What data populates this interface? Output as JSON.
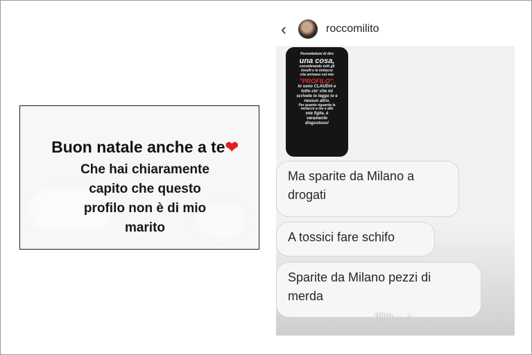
{
  "left_story": {
    "greeting": "Buon natale anche a te",
    "reply_lines": [
      "Che hai chiaramente",
      "capito che questo",
      "profilo non è di mio",
      "marito"
    ]
  },
  "dm": {
    "username": "roccomilito",
    "story_reply_text": [
      {
        "t": "Permettetemi di dire",
        "s": "xs"
      },
      {
        "t": "una cosa,",
        "s": "lg"
      },
      {
        "t": "considerando tutti gli",
        "s": "xs"
      },
      {
        "t": "insulti e le minacce",
        "s": "xs"
      },
      {
        "t": "che arrivano sul mio",
        "s": "xs"
      },
      {
        "t": "\"PROFILO\".",
        "s": "red"
      },
      {
        "t": "Io sono CLAUDIA e",
        "s": "sm"
      },
      {
        "t": "tutto cio' che mi",
        "s": "sm"
      },
      {
        "t": "scrivete lo leggo io e",
        "s": "sm"
      },
      {
        "t": "nessun altro.",
        "s": "sm"
      },
      {
        "t": "Per quanto riguarda le",
        "s": "xs"
      },
      {
        "t": "minacce a me e alle",
        "s": "xs"
      },
      {
        "t": "mie figlie, è",
        "s": "sm"
      },
      {
        "t": "veramente",
        "s": "sm"
      },
      {
        "t": "disgustoso!",
        "s": "sm"
      }
    ],
    "messages": [
      "Ma sparite da Milano a drogati",
      "A tossici fare schifo",
      "Sparite da Milano pezzi di merda"
    ],
    "more_label": "Altro..."
  },
  "icons": {
    "back": "chevron-left-icon",
    "heart": "heart-icon",
    "more": "chevron-right-icon"
  },
  "colors": {
    "heart": "#e02020",
    "story_bg": "#151515",
    "accent_red": "#e53030"
  }
}
